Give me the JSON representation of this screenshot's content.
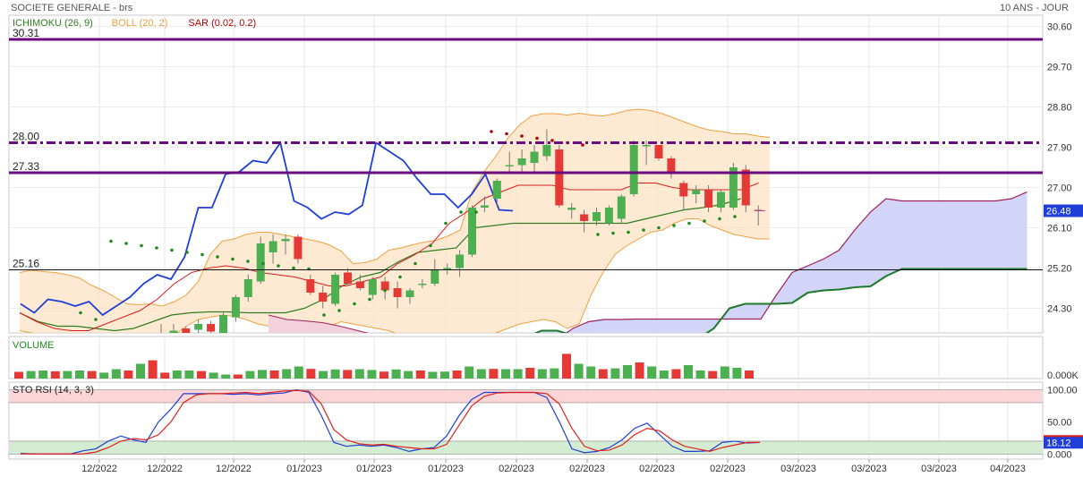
{
  "header": {
    "instrument": "SOCIETE GENERALE - brs",
    "period": "10 ANS - JOUR"
  },
  "legend": [
    {
      "label": "ICHIMOKU (26, 9)",
      "color": "#2e7d1e"
    },
    {
      "label": "BOLL (20, 2)",
      "color": "#e8a040"
    },
    {
      "label": "SAR (0.02, 0.2)",
      "color": "#b00000"
    }
  ],
  "colors": {
    "up": "#4caf50",
    "down": "#e53935",
    "lagging": "#1f3fd6",
    "hline": "#6a0c80",
    "boll_fill": "#fde3c4",
    "cloud_bull": "#cdd0f6",
    "cloud_bear": "#f2d0dc"
  },
  "chart_data": [
    {
      "type": "candlestick",
      "panel": "price",
      "ylim": [
        23.75,
        30.85
      ],
      "yticks": [
        "30.60",
        "29.70",
        "28.80",
        "27.90",
        "27.00",
        "26.10",
        "25.20",
        "24.30"
      ],
      "xticks": [
        "12/2022",
        "12/2022",
        "12/2022",
        "01/2023",
        "01/2023",
        "01/2023",
        "02/2023",
        "02/2023",
        "02/2023",
        "02/2023",
        "03/2023",
        "03/2023",
        "03/2023",
        "04/2023"
      ],
      "last_price": "26.48",
      "hlines": [
        {
          "label": "30.31",
          "value": 30.31,
          "style": "solid"
        },
        {
          "label": "28.00",
          "value": 28.0,
          "style": "dashdot"
        },
        {
          "label": "27.33",
          "value": 27.33,
          "style": "solid"
        },
        {
          "label": "25.16",
          "value": 25.16,
          "style": "thin"
        }
      ],
      "candles": [
        {
          "o": 23.62,
          "h": 23.95,
          "l": 23.35,
          "c": 23.75
        },
        {
          "o": 23.7,
          "h": 23.95,
          "l": 23.45,
          "c": 23.8
        },
        {
          "o": 23.85,
          "h": 23.9,
          "l": 23.5,
          "c": 23.72
        },
        {
          "o": 23.82,
          "h": 24.05,
          "l": 23.55,
          "c": 23.95
        },
        {
          "o": 23.95,
          "h": 24.02,
          "l": 23.6,
          "c": 23.78
        },
        {
          "o": 23.65,
          "h": 24.2,
          "l": 23.5,
          "c": 24.15
        },
        {
          "o": 24.1,
          "h": 24.6,
          "l": 24.0,
          "c": 24.55
        },
        {
          "o": 24.55,
          "h": 25.05,
          "l": 24.45,
          "c": 24.95
        },
        {
          "o": 24.9,
          "h": 25.9,
          "l": 24.85,
          "c": 25.75
        },
        {
          "o": 25.55,
          "h": 25.95,
          "l": 25.3,
          "c": 25.8
        },
        {
          "o": 25.8,
          "h": 25.95,
          "l": 25.5,
          "c": 25.85
        },
        {
          "o": 25.9,
          "h": 25.95,
          "l": 25.3,
          "c": 25.4
        },
        {
          "o": 24.95,
          "h": 25.05,
          "l": 24.6,
          "c": 24.65
        },
        {
          "o": 24.65,
          "h": 24.8,
          "l": 24.3,
          "c": 24.45
        },
        {
          "o": 24.4,
          "h": 25.1,
          "l": 24.35,
          "c": 25.05
        },
        {
          "o": 25.1,
          "h": 25.2,
          "l": 24.8,
          "c": 24.85
        },
        {
          "o": 24.9,
          "h": 25.05,
          "l": 24.7,
          "c": 24.75
        },
        {
          "o": 24.6,
          "h": 25.0,
          "l": 24.5,
          "c": 24.95
        },
        {
          "o": 24.9,
          "h": 25.0,
          "l": 24.5,
          "c": 24.7
        },
        {
          "o": 24.75,
          "h": 24.9,
          "l": 24.3,
          "c": 24.55
        },
        {
          "o": 24.55,
          "h": 24.75,
          "l": 24.4,
          "c": 24.7
        },
        {
          "o": 24.85,
          "h": 24.95,
          "l": 24.75,
          "c": 24.85
        },
        {
          "o": 24.85,
          "h": 25.4,
          "l": 24.8,
          "c": 25.15
        },
        {
          "o": 25.15,
          "h": 25.3,
          "l": 25.05,
          "c": 25.2
        },
        {
          "o": 25.2,
          "h": 25.6,
          "l": 25.0,
          "c": 25.5
        },
        {
          "o": 25.5,
          "h": 26.6,
          "l": 25.45,
          "c": 26.55
        },
        {
          "o": 26.55,
          "h": 26.8,
          "l": 26.45,
          "c": 26.6
        },
        {
          "o": 26.75,
          "h": 27.2,
          "l": 26.6,
          "c": 27.15
        },
        {
          "o": 27.5,
          "h": 27.8,
          "l": 27.3,
          "c": 27.5
        },
        {
          "o": 27.5,
          "h": 27.85,
          "l": 27.3,
          "c": 27.65
        },
        {
          "o": 27.55,
          "h": 27.95,
          "l": 27.3,
          "c": 27.8
        },
        {
          "o": 27.7,
          "h": 28.3,
          "l": 27.6,
          "c": 27.95
        },
        {
          "o": 27.85,
          "h": 27.95,
          "l": 26.55,
          "c": 26.6
        },
        {
          "o": 26.5,
          "h": 26.65,
          "l": 26.3,
          "c": 26.55
        },
        {
          "o": 26.4,
          "h": 26.5,
          "l": 26.0,
          "c": 26.25
        },
        {
          "o": 26.25,
          "h": 26.55,
          "l": 26.15,
          "c": 26.45
        },
        {
          "o": 26.2,
          "h": 26.6,
          "l": 26.15,
          "c": 26.55
        },
        {
          "o": 26.3,
          "h": 26.85,
          "l": 26.2,
          "c": 26.8
        },
        {
          "o": 26.85,
          "h": 28.05,
          "l": 26.8,
          "c": 27.95
        },
        {
          "o": 27.95,
          "h": 28.05,
          "l": 27.5,
          "c": 27.95
        },
        {
          "o": 27.95,
          "h": 27.95,
          "l": 27.6,
          "c": 27.65
        },
        {
          "o": 27.65,
          "h": 27.7,
          "l": 27.2,
          "c": 27.35
        },
        {
          "o": 27.1,
          "h": 27.15,
          "l": 26.5,
          "c": 26.8
        },
        {
          "o": 26.85,
          "h": 27.05,
          "l": 26.65,
          "c": 26.95
        },
        {
          "o": 26.95,
          "h": 27.05,
          "l": 26.45,
          "c": 26.55
        },
        {
          "o": 26.55,
          "h": 26.95,
          "l": 26.45,
          "c": 26.9
        },
        {
          "o": 26.55,
          "h": 27.55,
          "l": 26.5,
          "c": 27.45
        },
        {
          "o": 27.4,
          "h": 27.5,
          "l": 26.45,
          "c": 26.6
        },
        {
          "o": 26.5,
          "h": 26.6,
          "l": 26.15,
          "c": 26.48
        }
      ],
      "bollinger": {
        "upper": [
          25.1,
          25.15,
          25.12,
          25.1,
          25.05,
          24.98,
          24.82,
          24.7,
          24.55,
          24.4,
          24.38,
          24.4,
          24.35,
          24.45,
          24.6,
          24.9,
          25.5,
          25.8,
          25.85,
          25.95,
          26.0,
          26.0,
          25.95,
          25.9,
          25.85,
          25.8,
          25.72,
          25.58,
          25.3,
          25.32,
          25.4,
          25.6,
          25.65,
          25.72,
          25.78,
          25.82,
          25.92,
          26.05,
          26.9,
          27.35,
          27.7,
          28.1,
          28.4,
          28.6,
          28.65,
          28.65,
          28.62,
          28.66,
          28.62,
          28.6,
          28.65,
          28.72,
          28.75,
          28.72,
          28.65,
          28.55,
          28.45,
          28.35,
          28.28,
          28.25,
          28.2,
          28.2,
          28.15,
          28.12
        ],
        "lower": [
          23.8,
          23.75,
          23.7,
          23.65,
          23.62,
          23.58,
          23.5,
          23.45,
          23.4,
          23.4,
          23.45,
          23.5,
          23.6,
          23.7,
          23.9,
          24.05,
          24.1,
          24.15,
          24.12,
          24.05,
          23.95,
          23.9,
          23.85,
          23.82,
          23.8,
          23.8,
          23.9,
          24.0,
          23.95,
          23.9,
          23.85,
          23.8,
          23.7,
          23.6,
          23.5,
          23.45,
          23.45,
          23.55,
          23.55,
          23.65,
          23.75,
          23.85,
          23.95,
          24.0,
          24.05,
          24.0,
          23.85,
          23.95,
          24.6,
          25.1,
          25.5,
          25.7,
          25.85,
          26.0,
          26.05,
          26.2,
          26.3,
          26.3,
          26.15,
          26.05,
          25.95,
          25.9,
          25.85,
          25.85
        ],
        "middle": [
          24.42,
          24.45,
          24.42,
          24.4,
          24.35,
          24.3,
          24.2,
          24.1,
          24.0,
          23.95,
          23.95,
          23.97,
          24.0,
          24.1,
          24.25,
          24.45,
          24.75,
          24.95,
          24.98,
          25.0,
          24.98,
          24.95,
          24.9,
          24.86,
          24.82,
          24.8,
          24.8,
          24.8,
          24.6,
          24.6,
          24.6,
          24.7,
          24.7,
          24.7,
          24.7,
          24.7,
          24.75,
          24.85,
          25.25,
          25.5,
          25.7,
          25.95,
          26.15,
          26.3,
          26.4,
          26.4,
          26.3,
          26.35,
          26.6,
          26.85,
          27.1,
          27.2,
          27.3,
          27.35,
          27.35,
          27.35,
          27.35,
          27.3,
          27.2,
          27.15,
          27.1,
          27.05,
          27.0,
          26.98
        ]
      },
      "ichimoku": {
        "tenkan": [
          24.2,
          24.0,
          23.85,
          23.8,
          23.8,
          23.95,
          24.1,
          24.25,
          24.5,
          24.85,
          25.1,
          25.2,
          25.25,
          25.2,
          25.1,
          25.05,
          25.0,
          24.9,
          24.8,
          24.8,
          24.9,
          25.0,
          25.3,
          25.5,
          25.75,
          26.2,
          26.45,
          26.75,
          26.9,
          27.05,
          27.05,
          27.05,
          26.95,
          26.95,
          26.95,
          26.95,
          27.1,
          27.1,
          27.0,
          26.95,
          26.95,
          26.95,
          26.95,
          27.1
        ],
        "kijun": [
          24.2,
          24.0,
          23.9,
          23.9,
          23.85,
          23.8,
          23.85,
          24.0,
          24.15,
          24.2,
          24.22,
          24.22,
          24.2,
          24.2,
          24.2,
          24.3,
          24.5,
          24.8,
          25.0,
          25.1,
          25.35,
          25.55,
          25.6,
          25.65,
          26.1,
          26.15,
          26.2,
          26.2,
          26.2,
          26.2,
          26.2,
          26.2,
          26.2,
          26.3,
          26.4,
          26.5,
          26.55,
          26.62,
          26.75
        ],
        "lagging": [
          24.4,
          24.2,
          24.5,
          24.45,
          24.35,
          24.45,
          24.15,
          24.35,
          24.55,
          24.85,
          25.05,
          24.95,
          25.45,
          26.55,
          26.55,
          27.3,
          27.35,
          27.6,
          27.55,
          28.0,
          26.7,
          26.55,
          26.3,
          26.45,
          26.4,
          26.6,
          28.0,
          27.8,
          27.6,
          27.2,
          26.85,
          26.85,
          26.55,
          26.85,
          27.3,
          26.5,
          26.48
        ],
        "span_a": [
          23.05,
          23.1,
          23.3,
          23.6,
          23.85,
          24.0,
          24.05,
          24.05,
          24.06,
          24.06,
          24.06,
          24.06,
          24.06,
          24.06,
          24.06,
          24.06,
          24.06,
          24.6,
          25.1,
          25.25,
          25.4,
          25.6,
          26.05,
          26.45,
          26.75,
          26.7,
          26.7,
          26.7,
          26.7,
          26.7,
          26.7,
          26.7,
          26.75,
          26.9
        ],
        "span_b": [
          23.3,
          23.65,
          23.8,
          23.8,
          23.7,
          23.62,
          23.6,
          23.55,
          23.5,
          23.45,
          23.45,
          23.55,
          23.62,
          23.85,
          24.3,
          24.4,
          24.4,
          24.4,
          24.42,
          24.65,
          24.7,
          24.72,
          24.77,
          24.79,
          25.02,
          25.18,
          25.18,
          25.18,
          25.18,
          25.18,
          25.18,
          25.18,
          25.18,
          25.18
        ]
      },
      "sar": [
        24.2,
        24.05,
        25.8,
        25.75,
        25.7,
        25.65,
        25.6,
        25.55,
        25.5,
        25.45,
        25.4,
        25.35,
        25.3,
        25.25,
        25.2,
        25.18,
        24.15,
        24.25,
        24.4,
        24.5,
        24.7,
        25.0,
        25.3,
        25.7,
        26.2,
        26.45,
        26.45,
        28.25,
        28.2,
        28.15,
        28.1,
        28.05,
        28.0,
        27.95,
        25.95,
        25.98,
        26.0,
        26.05,
        26.1,
        26.15,
        26.2,
        26.25,
        26.3,
        26.35,
        28.0
      ]
    },
    {
      "type": "bar",
      "panel": "volume",
      "title": "VOLUME",
      "yticks": [
        "0.000K"
      ],
      "values": [
        0.25,
        0.28,
        0.3,
        0.27,
        0.28,
        0.3,
        0.28,
        0.22,
        0.35,
        0.3,
        0.55,
        0.68,
        0.22,
        0.3,
        0.3,
        0.28,
        0.22,
        0.15,
        0.15,
        0.28,
        0.32,
        0.3,
        0.35,
        0.45,
        0.36,
        0.28,
        0.34,
        0.32,
        0.35,
        0.32,
        0.26,
        0.34,
        0.28,
        0.3,
        0.25,
        0.26,
        0.3,
        0.45,
        0.35,
        0.36,
        0.35,
        0.35,
        0.4,
        0.35,
        0.38,
        0.92,
        0.55,
        0.45,
        0.35,
        0.38,
        0.5,
        0.6,
        0.45,
        0.3,
        0.35,
        0.5,
        0.3,
        0.28,
        0.45,
        0.4,
        0.3
      ]
    },
    {
      "type": "line",
      "panel": "oscillator",
      "title": "STO RSI (14, 3, 3)",
      "ylim": [
        -8,
        112
      ],
      "yticks": [
        "100.00",
        "50.00",
        "0.000"
      ],
      "last_value": "18.12",
      "zones": [
        {
          "from": 80,
          "to": 100,
          "color": "#fcd6d6"
        },
        {
          "from": 0,
          "to": 20,
          "color": "#d4ecd2"
        }
      ],
      "series": [
        {
          "color": "#1f3fd6",
          "values": [
            1,
            0,
            0,
            0,
            0,
            5,
            8,
            20,
            28,
            22,
            18,
            50,
            70,
            94,
            94,
            94,
            94,
            93,
            94,
            92,
            94,
            95,
            100,
            96,
            60,
            18,
            12,
            14,
            12,
            14,
            10,
            4,
            8,
            10,
            28,
            60,
            85,
            96,
            96,
            96,
            96,
            96,
            88,
            50,
            8,
            2,
            4,
            10,
            22,
            40,
            48,
            30,
            12,
            4,
            4,
            5,
            18,
            20,
            17,
            18
          ]
        },
        {
          "color": "#e0201a",
          "values": [
            0,
            0,
            0,
            0,
            0,
            0,
            3,
            10,
            20,
            24,
            22,
            30,
            50,
            80,
            92,
            94,
            94,
            95,
            96,
            94,
            96,
            98,
            99,
            98,
            78,
            38,
            22,
            16,
            14,
            15,
            12,
            10,
            8,
            8,
            15,
            45,
            75,
            90,
            95,
            96,
            96,
            96,
            94,
            78,
            40,
            12,
            5,
            6,
            14,
            30,
            40,
            36,
            22,
            12,
            8,
            4,
            10,
            14,
            18,
            18
          ]
        }
      ]
    }
  ]
}
